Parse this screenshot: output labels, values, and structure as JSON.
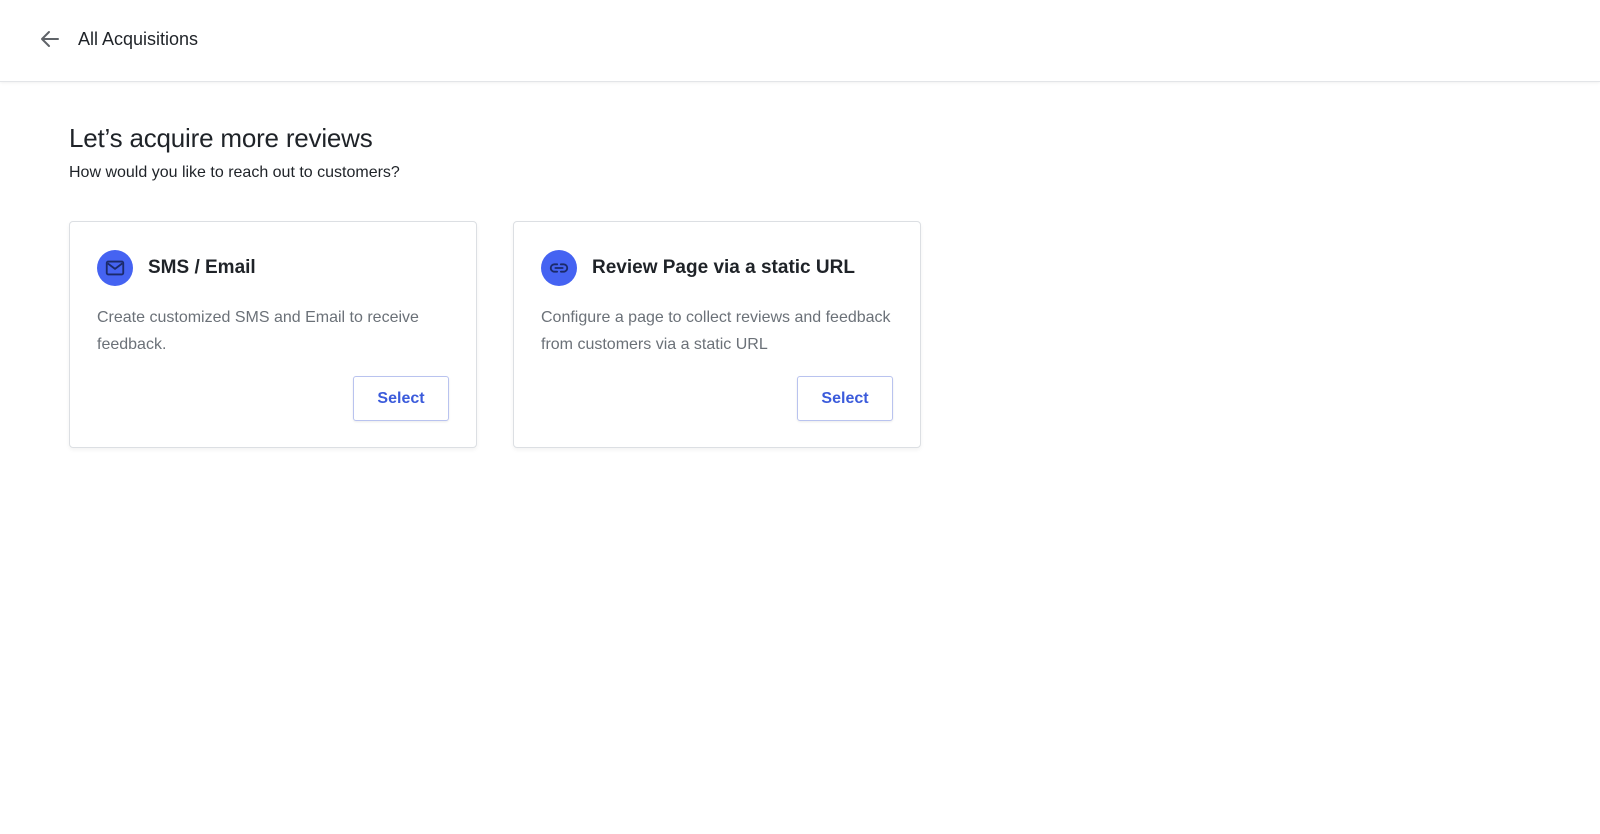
{
  "header": {
    "back_label": "All Acquisitions"
  },
  "main": {
    "title": "Let’s acquire more reviews",
    "subtitle": "How would you like to reach out to customers?"
  },
  "cards": [
    {
      "icon": "mail-icon",
      "title": "SMS / Email",
      "description": "Create customized SMS and Email to receive feedback.",
      "button_label": "Select"
    },
    {
      "icon": "link-icon",
      "title": "Review Page via a static URL",
      "description": "Configure a page to collect reviews and feedback from customers via a static URL",
      "button_label": "Select"
    }
  ],
  "colors": {
    "accent": "#4563f2",
    "button_text": "#3b5bdb",
    "description_text": "#6b7178"
  }
}
